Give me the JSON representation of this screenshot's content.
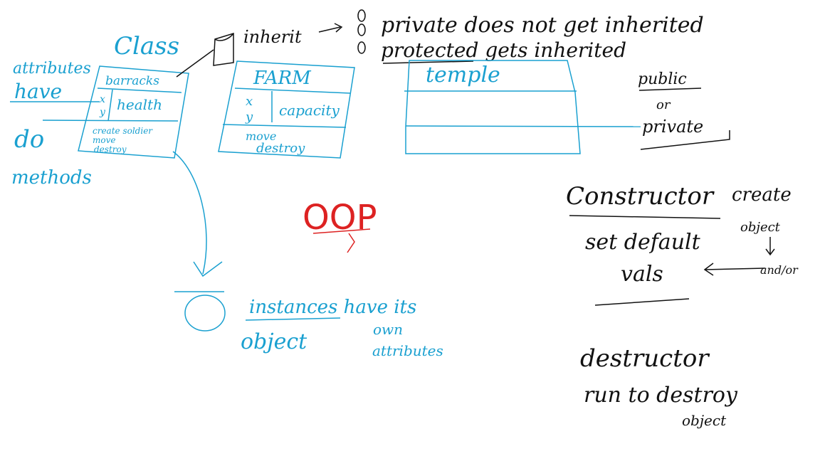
{
  "colors": {
    "blue_ink": "#1aa0d0",
    "black_ink": "#111111",
    "red_ink": "#dd2222"
  },
  "left_notes": {
    "attributes": "attributes",
    "have": "have",
    "do": "do",
    "methods": "methods"
  },
  "class_box": {
    "header": "Class",
    "name": "barracks",
    "attr_x": "x",
    "attr_y": "y",
    "attr_health": "health",
    "methods": [
      "create soldier",
      "move",
      "destroy"
    ]
  },
  "farm_box": {
    "name": "FARM",
    "attr_x": "x",
    "attr_y": "y",
    "attr_capacity": "capacity",
    "methods": [
      "move",
      "destroy"
    ]
  },
  "temple_box": {
    "name": "temple"
  },
  "inherit_note": {
    "label": "inherit",
    "private_line": "private  does not get  inherited",
    "protected_line": "protected   gets inherited"
  },
  "visibility_note": {
    "public": "public",
    "or": "or",
    "private": "private"
  },
  "center_label": "OOP",
  "object_note": {
    "object": "object",
    "instances": "instances have its",
    "own": "own",
    "attributes": "attributes"
  },
  "constructor_note": {
    "title": "Constructor",
    "create": "create",
    "object": "object",
    "set_default": "set default",
    "vals": "vals",
    "and_or": "and/or"
  },
  "destructor_note": {
    "title": "destructor",
    "run": "run to destroy",
    "object": "object"
  }
}
